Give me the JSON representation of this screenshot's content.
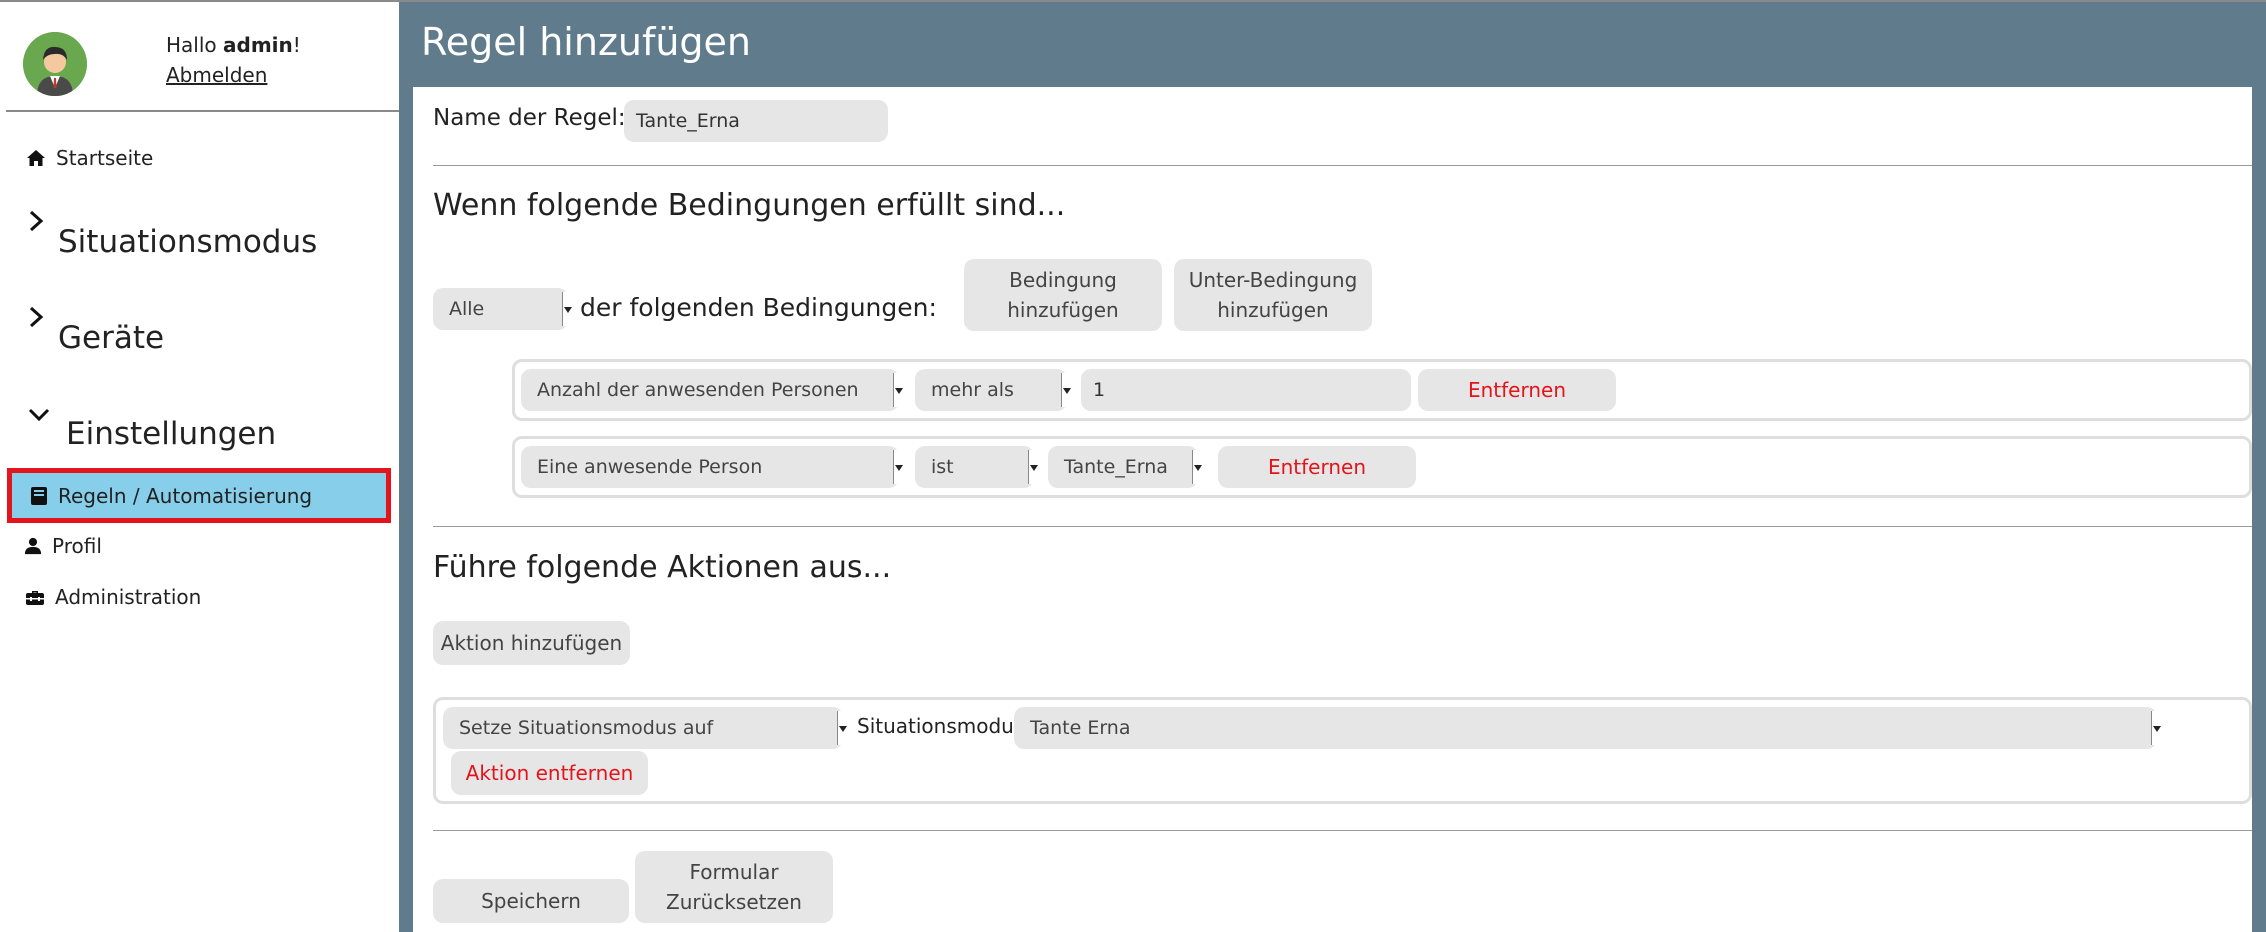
{
  "user": {
    "greeting_prefix": "Hallo ",
    "username": "admin",
    "greeting_suffix": "!",
    "logout_label": "Abmelden"
  },
  "sidebar": {
    "home_label": "Startseite",
    "groups": [
      {
        "label": "Situationsmodus",
        "expanded": false
      },
      {
        "label": "Geräte",
        "expanded": false
      },
      {
        "label": "Einstellungen",
        "expanded": true
      }
    ],
    "sub_items": [
      {
        "label": "Regeln / Automatisierung",
        "icon": "book-icon",
        "active": true
      },
      {
        "label": "Profil",
        "icon": "user-icon",
        "active": false
      },
      {
        "label": "Administration",
        "icon": "toolbox-icon",
        "active": false
      }
    ],
    "active_bg": "#87ceeb",
    "highlight_color": "#e3141b"
  },
  "main": {
    "title": "Regel hinzufügen",
    "header_bg": "#5f7b8c",
    "rule_name_label": "Name der Regel:",
    "rule_name_value": "Tante_Erna",
    "conditions_heading": "Wenn folgende Bedingungen erfüllt sind...",
    "match_select": "Alle",
    "match_text": "der folgenden Bedingungen:",
    "add_condition_line1": "Bedingung",
    "add_condition_line2": "hinzufügen",
    "add_subcondition_line1": "Unter-Bedingung",
    "add_subcondition_line2": "hinzufügen",
    "conditions": [
      {
        "subject": "Anzahl der anwesenden Personen",
        "operator": "mehr als",
        "value": "1",
        "remove_label": "Entfernen"
      },
      {
        "subject": "Eine anwesende Person",
        "operator": "ist",
        "value": "Tante_Erna",
        "remove_label": "Entfernen"
      }
    ],
    "actions_heading": "Führe folgende Aktionen aus...",
    "add_action_label": "Aktion hinzufügen",
    "action": {
      "type": "Setze Situationsmodus auf",
      "param_label": "Situationsmodus:",
      "param_value": "Tante Erna",
      "remove_label": "Aktion entfernen"
    },
    "save_label": "Speichern",
    "reset_line1": "Formular",
    "reset_line2": "Zurücksetzen"
  }
}
